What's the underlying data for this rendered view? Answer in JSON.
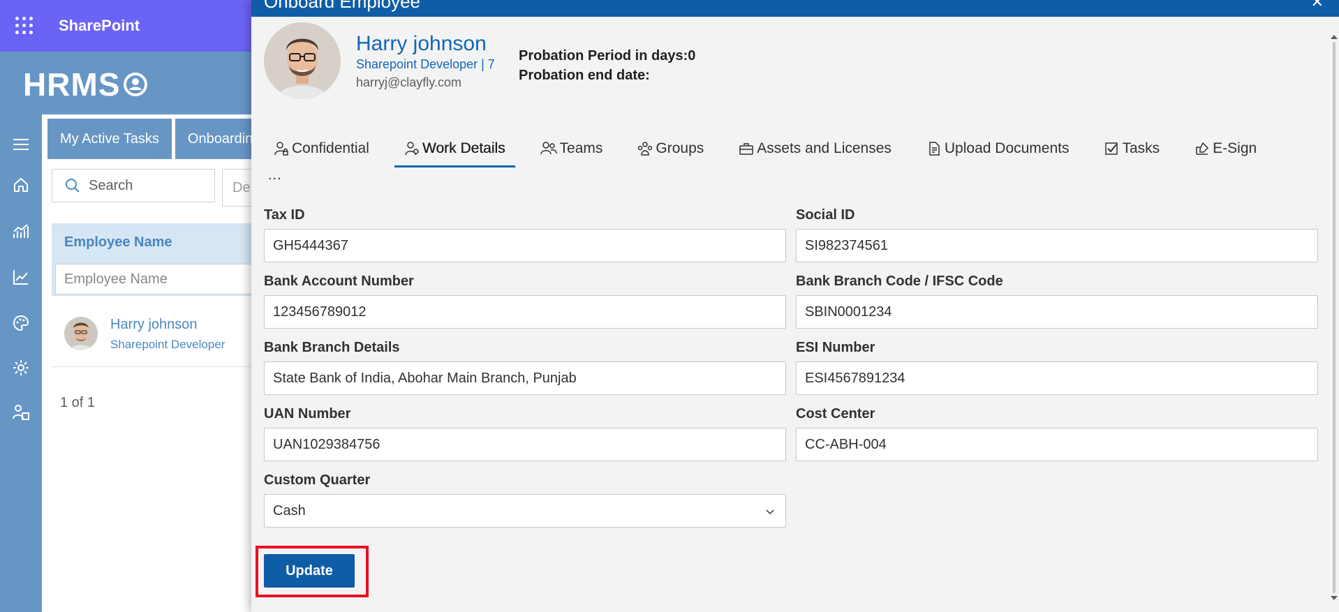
{
  "suite_bar": {
    "app_name": "SharePoint"
  },
  "app_header": {
    "logo_text": "HRMS"
  },
  "left_rail": {
    "icons": [
      "menu-icon",
      "home-icon",
      "analytics-icon",
      "trending-icon",
      "palette-icon",
      "settings-icon",
      "people-admin-icon"
    ]
  },
  "background_page": {
    "tabs": [
      "My Active Tasks",
      "Onboardin"
    ],
    "search_placeholder": "Search",
    "filter_partial": "De",
    "table": {
      "column_title": "Employee Name",
      "column_filter_placeholder": "Employee Name",
      "rows": [
        {
          "name": "Harry johnson",
          "role": "Sharepoint Developer"
        }
      ]
    },
    "pager": "1 of 1"
  },
  "panel": {
    "title": "Onboard Employee",
    "close_glyph": "✕",
    "employee": {
      "name": "Harry johnson",
      "role_line": "Sharepoint Developer | 7",
      "email": "harryj@clayfly.com",
      "probation_days": "Probation Period in days:0",
      "probation_end": "Probation end date:"
    },
    "tabs": [
      {
        "label": "Confidential",
        "icon": "person-lock-icon"
      },
      {
        "label": "Work Details",
        "icon": "person-icon"
      },
      {
        "label": "Teams",
        "icon": "teams-icon"
      },
      {
        "label": "Groups",
        "icon": "groups-icon"
      },
      {
        "label": "Assets and Licenses",
        "icon": "briefcase-icon"
      },
      {
        "label": "Upload Documents",
        "icon": "document-icon"
      },
      {
        "label": "Tasks",
        "icon": "checkbox-icon"
      },
      {
        "label": "E-Sign",
        "icon": "sign-icon"
      }
    ],
    "active_tab": "Work Details",
    "more_tabs": "...",
    "form": {
      "tax_id": {
        "label": "Tax ID",
        "value": "GH5444367"
      },
      "social_id": {
        "label": "Social ID",
        "value": "SI982374561"
      },
      "bank_account": {
        "label": "Bank Account Number",
        "value": "123456789012"
      },
      "bank_branch_code": {
        "label": "Bank Branch Code / IFSC Code",
        "value": "SBIN0001234"
      },
      "bank_branch_details": {
        "label": "Bank Branch Details",
        "value": "State Bank of India, Abohar Main Branch, Punjab"
      },
      "esi_number": {
        "label": "ESI Number",
        "value": "ESI4567891234"
      },
      "uan_number": {
        "label": "UAN Number",
        "value": "UAN1029384756"
      },
      "cost_center": {
        "label": "Cost Center",
        "value": "CC-ABH-004"
      },
      "custom_quarter": {
        "label": "Custom Quarter",
        "value": "Cash"
      }
    },
    "update_label": "Update"
  },
  "colors": {
    "suite_bar": "#6b63f5",
    "app_header": "#6796c4",
    "panel_accent": "#0f5da6",
    "highlight_outline": "#e81123"
  }
}
